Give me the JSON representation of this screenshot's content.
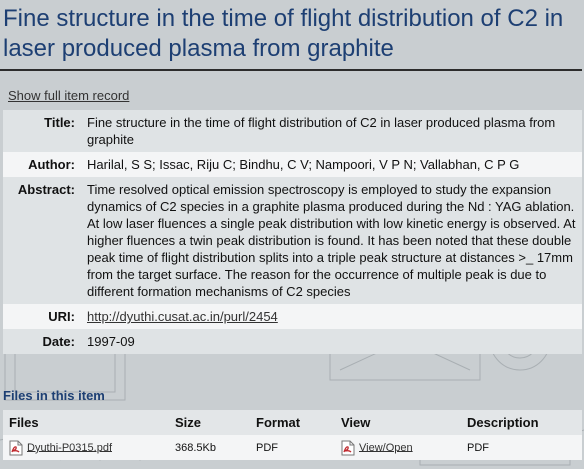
{
  "item": {
    "title": "Fine structure in the time of flight distribution of C2 in laser produced plasma from graphite",
    "show_full_label": "Show full item record"
  },
  "metadata": [
    {
      "label": "Title:",
      "value": "Fine structure in the time of flight distribution of C2 in laser produced plasma from graphite"
    },
    {
      "label": "Author:",
      "value": "Harilal, S S; Issac, Riju C; Bindhu, C V; Nampoori, V P N; Vallabhan, C P G"
    },
    {
      "label": "Abstract:",
      "value": "Time resolved optical emission spectroscopy is employed to study the expansion dynamics of C2 species in a graphite plasma produced during the Nd : YAG ablation. At low laser fluences a single peak distribution with low kinetic energy is observed. At higher fluences a twin peak distribution is found. It has been noted that these double peak time of flight distribution splits into a triple peak structure at distances >_ 17mm from the target surface. The reason for the occurrence of multiple peak is due to different formation mechanisms of C2 species"
    },
    {
      "label": "URI:",
      "value": "http://dyuthi.cusat.ac.in/purl/2454"
    },
    {
      "label": "Date:",
      "value": "1997-09"
    }
  ],
  "files_section": {
    "heading": "Files in this item",
    "columns": [
      "Files",
      "Size",
      "Format",
      "View",
      "Description"
    ],
    "rows": [
      {
        "file": "Dyuthi-P0315.pdf",
        "size": "368.5Kb",
        "format": "PDF",
        "view": "View/Open",
        "description": "PDF",
        "icon": "pdf-icon"
      }
    ]
  },
  "colors": {
    "title": "#1d3f73",
    "background": "#c9ced1",
    "row_odd": "#dfe3e5",
    "row_even": "#f4f5f6"
  }
}
